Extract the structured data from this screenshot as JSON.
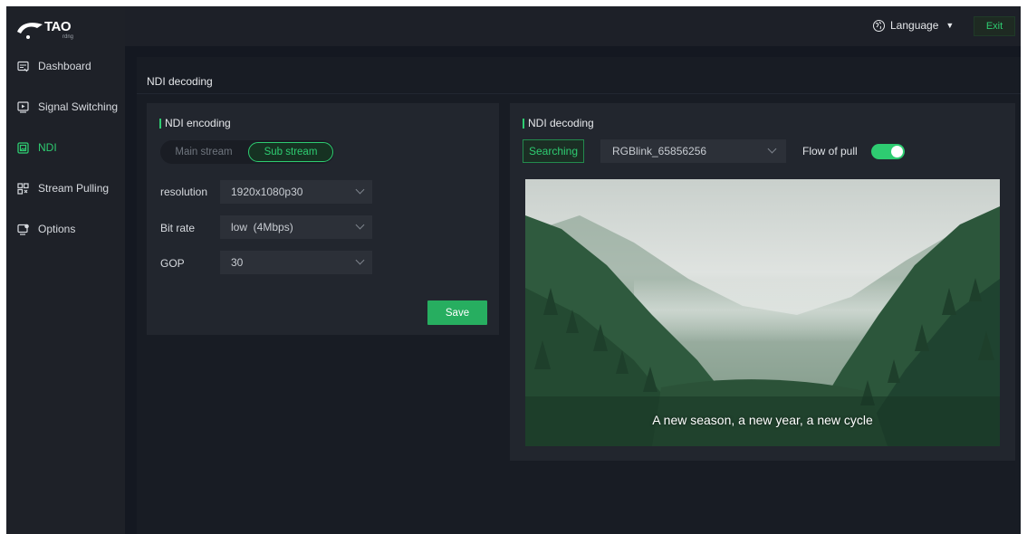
{
  "brand": {
    "logo_text": "TAO",
    "logo_sub": "rdng"
  },
  "topbar": {
    "language_label": "Language",
    "exit_label": "Exit"
  },
  "sidebar": {
    "items": [
      {
        "label": "Dashboard",
        "icon": "dashboard-icon"
      },
      {
        "label": "Signal Switching",
        "icon": "signal-switching-icon"
      },
      {
        "label": "NDI",
        "icon": "ndi-icon",
        "active": true
      },
      {
        "label": "Stream Pulling",
        "icon": "stream-pulling-icon"
      },
      {
        "label": "Options",
        "icon": "options-icon"
      }
    ]
  },
  "page": {
    "title": "NDI decoding"
  },
  "encoding_panel": {
    "title": "NDI encoding",
    "tabs": {
      "main": "Main stream",
      "sub": "Sub stream",
      "selected": "Sub stream"
    },
    "fields": [
      {
        "label": "resolution",
        "value": "1920x1080p30"
      },
      {
        "label": "Bit rate",
        "value": "low  (4Mbps)"
      },
      {
        "label": "GOP",
        "value": "30"
      }
    ],
    "save_label": "Save"
  },
  "decoding_panel": {
    "title": "NDI decoding",
    "search_label": "Searching",
    "source_value": "RGBlink_65856256",
    "flow_label": "Flow of pull",
    "flow_enabled": true,
    "preview_caption": "A new season, a new year, a new cycle"
  },
  "colors": {
    "accent": "#2ecc71",
    "background": "#141821",
    "panel": "#22262e"
  }
}
